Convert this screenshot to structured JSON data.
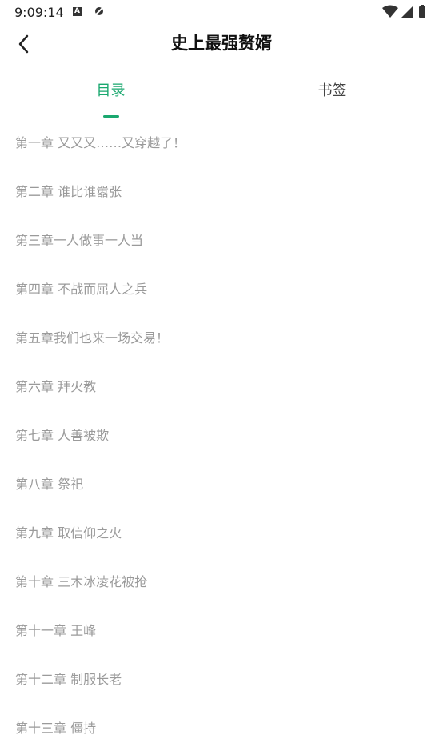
{
  "status": {
    "time": "9:09:14",
    "icons": [
      "a-notification-icon",
      "no-signal-icon",
      "wifi-icon",
      "cell-signal-icon",
      "battery-icon"
    ]
  },
  "header": {
    "title": "史上最强赘婿",
    "back_icon": "back-arrow-icon"
  },
  "tabs": [
    {
      "label": "目录",
      "active": true
    },
    {
      "label": "书签",
      "active": false
    }
  ],
  "colors": {
    "accent": "#1aa86f",
    "item_text": "#9a9a9a"
  },
  "chapters": [
    "第一章 又又又……又穿越了！",
    "第二章 谁比谁嚣张",
    "第三章一人做事一人当",
    "第四章 不战而屈人之兵",
    "第五章我们也来一场交易！",
    "第六章 拜火教",
    "第七章 人善被欺",
    "第八章 祭祀",
    "第九章 取信仰之火",
    "第十章 三木冰凌花被抢",
    "第十一章 王峰",
    "第十二章 制服长老",
    "第十三章 僵持"
  ]
}
